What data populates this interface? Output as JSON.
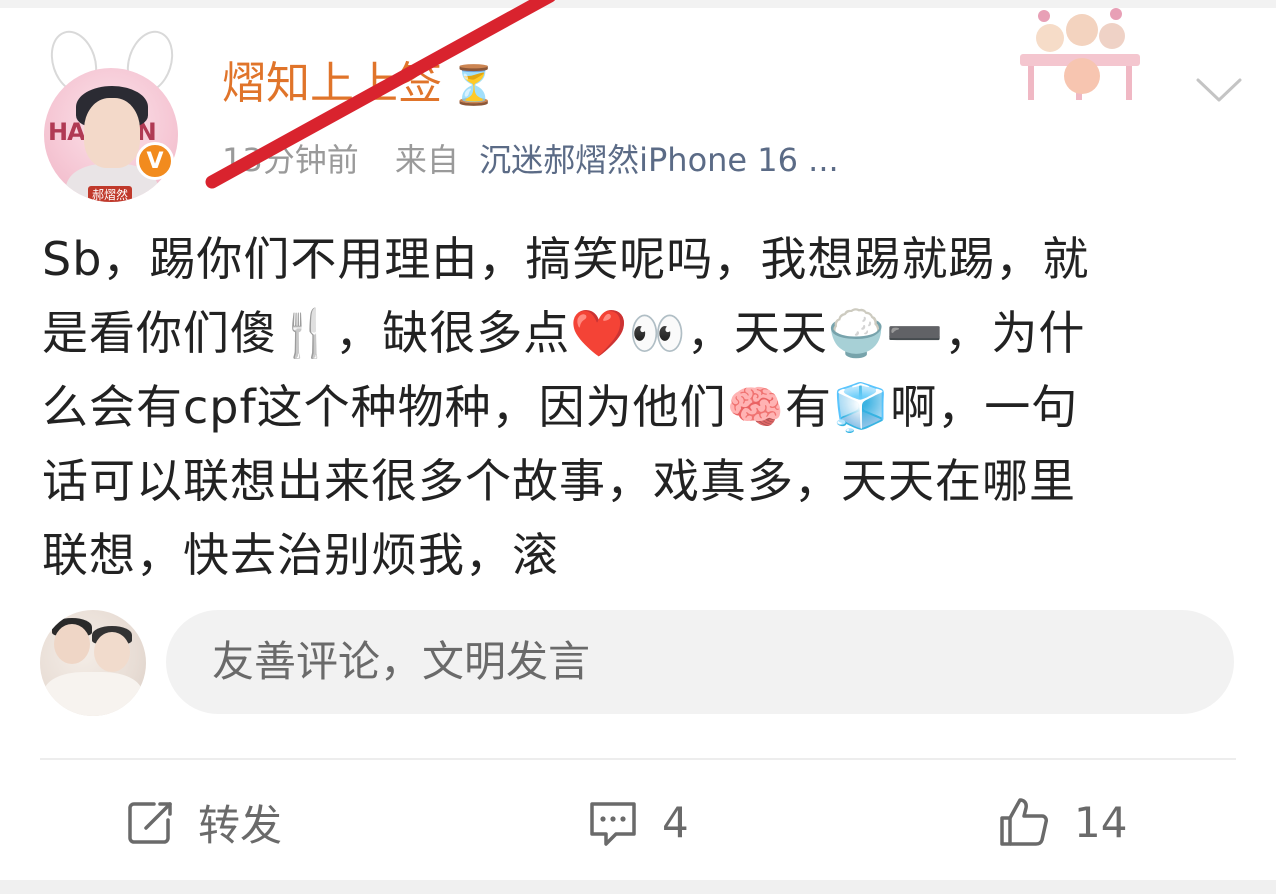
{
  "post": {
    "username": "熠知上上签",
    "username_emoji": "⏳",
    "time": "13分钟前",
    "from_label": "来自",
    "source": "沉迷郝熠然iPhone 16 ...",
    "avatar_text": "HAI NAN",
    "avatar_name_tag": "郝熠然",
    "verified_badge": "V",
    "text_lines": [
      "Sb，踢你们不用理由，搞笑呢吗，我想踢就踢，就",
      "是看你们傻🍴，缺很多点❤️👀，天天🍚➖，为什",
      "么会有cpf这个种物种，因为他们🧠有🧊啊，一句",
      "话可以联想出来很多个故事，戏真多，天天在哪里",
      "联想，快去治别烦我，滚"
    ]
  },
  "comment_box": {
    "placeholder": "友善评论，文明发言"
  },
  "actions": {
    "repost_label": "转发",
    "comment_count": "4",
    "like_count": "14"
  },
  "icons": {
    "repost": "repost-icon",
    "comment": "comment-icon",
    "like": "like-icon",
    "more": "chevron-down-icon"
  },
  "colors": {
    "username": "#e0742a",
    "source": "#5b6b86",
    "meta": "#9a9a9a",
    "annotation_stroke": "#d9232e",
    "verify_badge": "#f28b1e"
  }
}
